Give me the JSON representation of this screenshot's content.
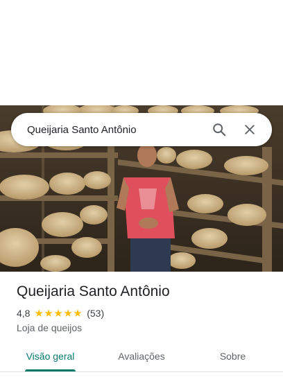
{
  "search": {
    "value": "Queijaria Santo Antônio",
    "search_icon": "search-icon",
    "close_icon": "close-icon"
  },
  "place": {
    "name": "Queijaria Santo Antônio",
    "rating": "4,8",
    "stars": 5,
    "review_count": "(53)",
    "category": "Loja de queijos"
  },
  "tabs": [
    {
      "label": "Visão geral",
      "active": true
    },
    {
      "label": "Avaliações",
      "active": false
    },
    {
      "label": "Sobre",
      "active": false
    }
  ],
  "colors": {
    "accent": "#00796b",
    "star": "#fbbc04",
    "text": "#202124",
    "secondary_text": "#5f6368"
  }
}
